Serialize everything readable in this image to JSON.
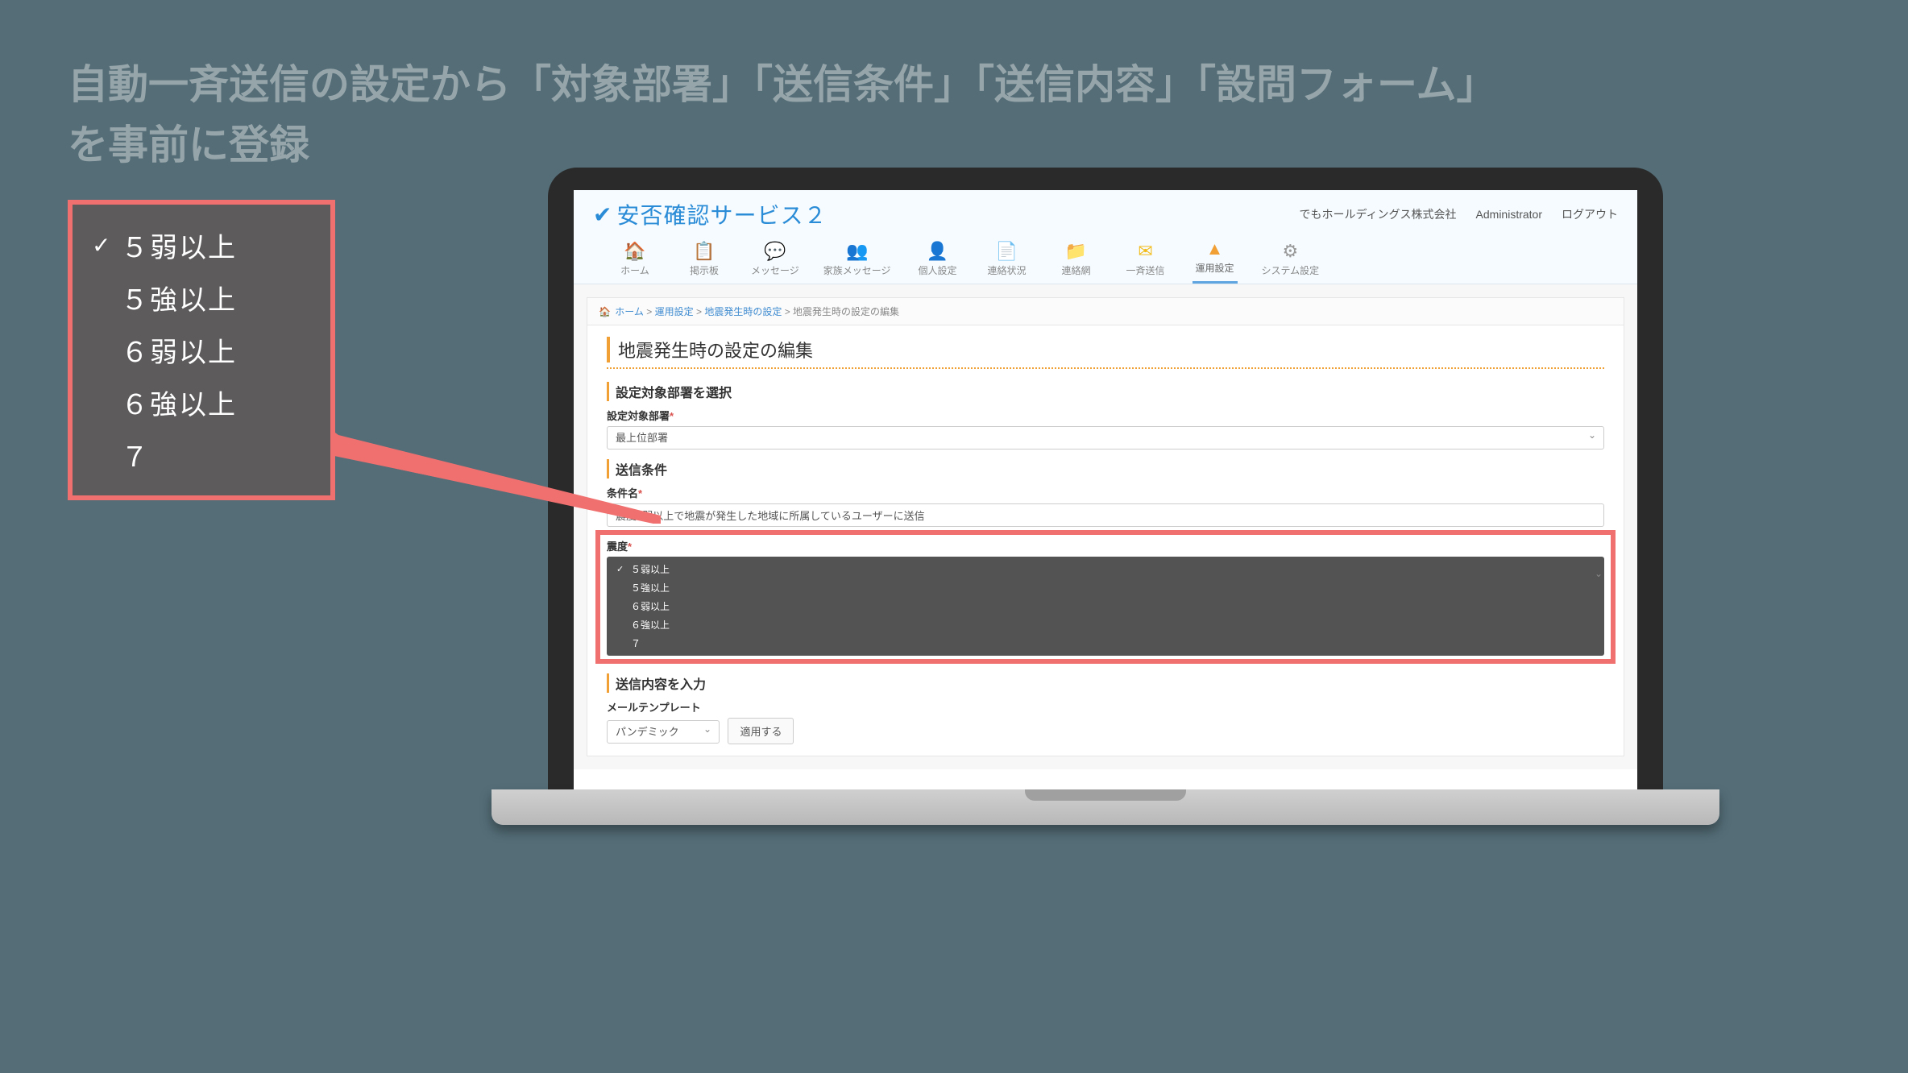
{
  "slide": {
    "title": "自動一斉送信の設定から「対象部署」「送信条件」「送信内容」「設問フォーム」を事前に登録"
  },
  "callout": {
    "options": [
      "５弱以上",
      "５強以上",
      "６弱以上",
      "６強以上",
      "７"
    ],
    "selectedIndex": 0
  },
  "app": {
    "brand": "安否確認サービス２",
    "account": {
      "company": "でもホールディングス株式会社",
      "user": "Administrator",
      "logout": "ログアウト"
    },
    "nav": [
      {
        "icon": "🏠",
        "label": "ホーム",
        "colorClass": "nav-color-blue"
      },
      {
        "icon": "📋",
        "label": "掲示板",
        "colorClass": "nav-color-blue2"
      },
      {
        "icon": "💬",
        "label": "メッセージ",
        "colorClass": "nav-color-cyan"
      },
      {
        "icon": "👥",
        "label": "家族メッセージ",
        "colorClass": "nav-color-cyan2"
      },
      {
        "icon": "👤",
        "label": "個人設定",
        "colorClass": "nav-color-navy"
      },
      {
        "icon": "📄",
        "label": "連絡状況",
        "colorClass": "nav-color-green"
      },
      {
        "icon": "📁",
        "label": "連絡網",
        "colorClass": "nav-color-amber"
      },
      {
        "icon": "✉",
        "label": "一斉送信",
        "colorClass": "nav-color-yellow"
      },
      {
        "icon": "▲",
        "label": "運用設定",
        "colorClass": "nav-color-orange",
        "active": true
      },
      {
        "icon": "⚙",
        "label": "システム設定",
        "colorClass": "nav-color-gray"
      }
    ],
    "breadcrumb": {
      "home": "ホーム",
      "sep": " > ",
      "l1": "運用設定",
      "l2": "地震発生時の設定",
      "current": "地震発生時の設定の編集"
    },
    "page": {
      "title": "地震発生時の設定の編集",
      "section_department": "設定対象部署を選択",
      "department_label": "設定対象部署",
      "department_value": "最上位部署",
      "section_condition": "送信条件",
      "condition_name_label": "条件名",
      "condition_name_value": "震度5弱以上で地震が発生した地域に所属しているユーザーに送信",
      "intensity_label": "震度",
      "intensity_options": [
        "５弱以上",
        "５強以上",
        "６弱以上",
        "６強以上",
        "７"
      ],
      "intensity_selectedIndex": 0,
      "section_content": "送信内容を入力",
      "template_label": "メールテンプレート",
      "template_value": "パンデミック",
      "apply_label": "適用する",
      "required_mark": "*"
    }
  }
}
